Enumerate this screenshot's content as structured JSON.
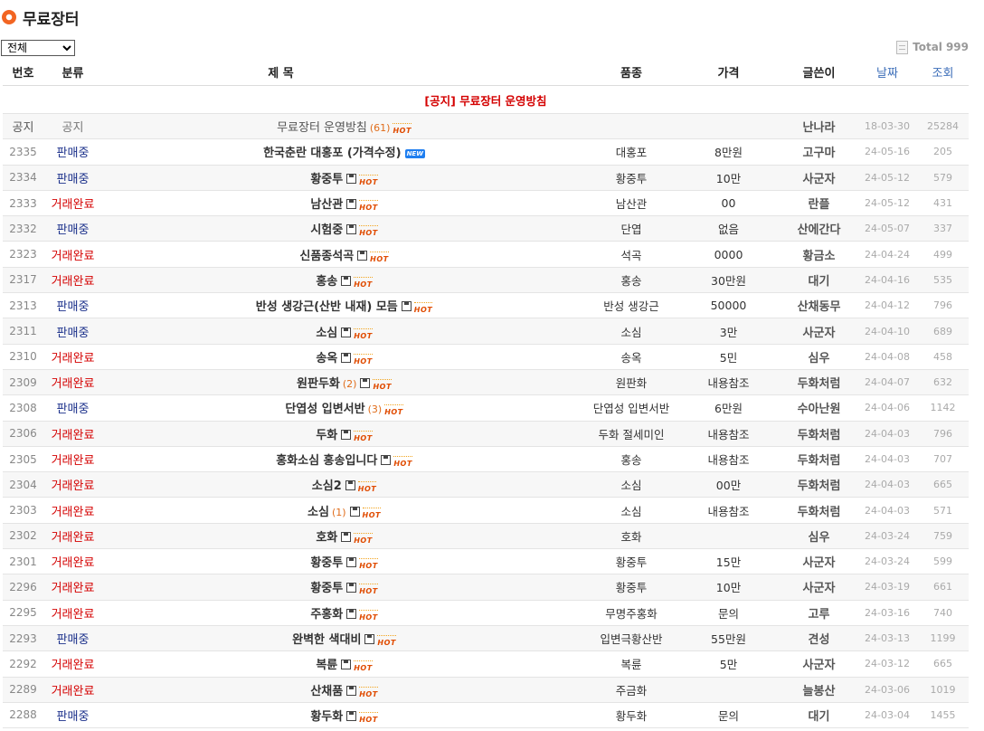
{
  "board": {
    "title": "무료장터",
    "filter": {
      "selected": "전체"
    },
    "total_label": "Total",
    "total_count": "999"
  },
  "columns": {
    "num": "번호",
    "cat": "분류",
    "subject": "제 목",
    "item": "품종",
    "price": "가격",
    "author": "글쓴이",
    "date": "날짜",
    "views": "조회"
  },
  "notice_banner": "[공지] 무료장터 운영방침",
  "rows": [
    {
      "num": "공지",
      "cat": "공지",
      "status": "notice",
      "subject": "무료장터 운영방침",
      "comments": "(61)",
      "file": false,
      "hot": true,
      "new": false,
      "item": "",
      "price": "",
      "author": "난나라",
      "date": "18-03-30",
      "views": "25284"
    },
    {
      "num": "2335",
      "cat": "판매중",
      "status": "sale",
      "subject": "한국춘란 대홍포 (가격수정)",
      "comments": "",
      "file": false,
      "hot": false,
      "new": true,
      "item": "대홍포",
      "price": "8만원",
      "author": "고구마",
      "date": "24-05-16",
      "views": "205"
    },
    {
      "num": "2334",
      "cat": "판매중",
      "status": "sale",
      "subject": "황중투",
      "comments": "",
      "file": true,
      "hot": true,
      "new": false,
      "item": "황중투",
      "price": "10만",
      "author": "사군자",
      "date": "24-05-12",
      "views": "579"
    },
    {
      "num": "2333",
      "cat": "거래완료",
      "status": "done",
      "subject": "남산관",
      "comments": "",
      "file": true,
      "hot": true,
      "new": false,
      "item": "남산관",
      "price": "00",
      "author": "란플",
      "date": "24-05-12",
      "views": "431"
    },
    {
      "num": "2332",
      "cat": "판매중",
      "status": "sale",
      "subject": "시험중",
      "comments": "",
      "file": true,
      "hot": true,
      "new": false,
      "item": "단엽",
      "price": "없음",
      "author": "산에간다",
      "date": "24-05-07",
      "views": "337"
    },
    {
      "num": "2323",
      "cat": "거래완료",
      "status": "done",
      "subject": "신품종석곡",
      "comments": "",
      "file": true,
      "hot": true,
      "new": false,
      "item": "석곡",
      "price": "0000",
      "author": "황금소",
      "date": "24-04-24",
      "views": "499"
    },
    {
      "num": "2317",
      "cat": "거래완료",
      "status": "done",
      "subject": "홍송",
      "comments": "",
      "file": true,
      "hot": true,
      "new": false,
      "item": "홍송",
      "price": "30만원",
      "author": "대기",
      "date": "24-04-16",
      "views": "535"
    },
    {
      "num": "2313",
      "cat": "판매중",
      "status": "sale",
      "subject": "반성 생강근(산반 내재) 모듬",
      "comments": "",
      "file": true,
      "hot": true,
      "new": false,
      "item": "반성 생강근",
      "price": "50000",
      "author": "산채동무",
      "date": "24-04-12",
      "views": "796"
    },
    {
      "num": "2311",
      "cat": "판매중",
      "status": "sale",
      "subject": "소심",
      "comments": "",
      "file": true,
      "hot": true,
      "new": false,
      "item": "소심",
      "price": "3만",
      "author": "사군자",
      "date": "24-04-10",
      "views": "689"
    },
    {
      "num": "2310",
      "cat": "거래완료",
      "status": "done",
      "subject": "송옥",
      "comments": "",
      "file": true,
      "hot": true,
      "new": false,
      "item": "송옥",
      "price": "5민",
      "author": "심우",
      "date": "24-04-08",
      "views": "458"
    },
    {
      "num": "2309",
      "cat": "거래완료",
      "status": "done",
      "subject": "원판두화",
      "comments": "(2)",
      "file": true,
      "hot": true,
      "new": false,
      "item": "원판화",
      "price": "내용참조",
      "author": "두화처럼",
      "date": "24-04-07",
      "views": "632"
    },
    {
      "num": "2308",
      "cat": "판매중",
      "status": "sale",
      "subject": "단엽성 입변서반",
      "comments": "(3)",
      "file": false,
      "hot": true,
      "new": false,
      "item": "단엽성 입변서반",
      "price": "6만원",
      "author": "수아난원",
      "date": "24-04-06",
      "views": "1142"
    },
    {
      "num": "2306",
      "cat": "거래완료",
      "status": "done",
      "subject": "두화",
      "comments": "",
      "file": true,
      "hot": true,
      "new": false,
      "item": "두화 절세미인",
      "price": "내용참조",
      "author": "두화처럼",
      "date": "24-04-03",
      "views": "796"
    },
    {
      "num": "2305",
      "cat": "거래완료",
      "status": "done",
      "subject": "홍화소심 홍송입니다",
      "comments": "",
      "file": true,
      "hot": true,
      "new": false,
      "item": "홍송",
      "price": "내용참조",
      "author": "두화처럼",
      "date": "24-04-03",
      "views": "707"
    },
    {
      "num": "2304",
      "cat": "거래완료",
      "status": "done",
      "subject": "소심2",
      "comments": "",
      "file": true,
      "hot": true,
      "new": false,
      "item": "소심",
      "price": "00만",
      "author": "두화처럼",
      "date": "24-04-03",
      "views": "665"
    },
    {
      "num": "2303",
      "cat": "거래완료",
      "status": "done",
      "subject": "소심",
      "comments": "(1)",
      "file": true,
      "hot": true,
      "new": false,
      "item": "소심",
      "price": "내용참조",
      "author": "두화처럼",
      "date": "24-04-03",
      "views": "571"
    },
    {
      "num": "2302",
      "cat": "거래완료",
      "status": "done",
      "subject": "호화",
      "comments": "",
      "file": true,
      "hot": true,
      "new": false,
      "item": "호화",
      "price": "",
      "author": "심우",
      "date": "24-03-24",
      "views": "759"
    },
    {
      "num": "2301",
      "cat": "거래완료",
      "status": "done",
      "subject": "황중투",
      "comments": "",
      "file": true,
      "hot": true,
      "new": false,
      "item": "황중투",
      "price": "15만",
      "author": "사군자",
      "date": "24-03-24",
      "views": "599"
    },
    {
      "num": "2296",
      "cat": "거래완료",
      "status": "done",
      "subject": "황중투",
      "comments": "",
      "file": true,
      "hot": true,
      "new": false,
      "item": "황중투",
      "price": "10만",
      "author": "사군자",
      "date": "24-03-19",
      "views": "661"
    },
    {
      "num": "2295",
      "cat": "거래완료",
      "status": "done",
      "subject": "주홍화",
      "comments": "",
      "file": true,
      "hot": true,
      "new": false,
      "item": "무명주홍화",
      "price": "문의",
      "author": "고루",
      "date": "24-03-16",
      "views": "740"
    },
    {
      "num": "2293",
      "cat": "판매중",
      "status": "sale",
      "subject": "완벽한 색대비",
      "comments": "",
      "file": true,
      "hot": true,
      "new": false,
      "item": "입변극황산반",
      "price": "55만원",
      "author": "견성",
      "date": "24-03-13",
      "views": "1199"
    },
    {
      "num": "2292",
      "cat": "거래완료",
      "status": "done",
      "subject": "복륜",
      "comments": "",
      "file": true,
      "hot": true,
      "new": false,
      "item": "복륜",
      "price": "5만",
      "author": "사군자",
      "date": "24-03-12",
      "views": "665"
    },
    {
      "num": "2289",
      "cat": "거래완료",
      "status": "done",
      "subject": "산채품",
      "comments": "",
      "file": true,
      "hot": true,
      "new": false,
      "item": "주금화",
      "price": "",
      "author": "늘봉산",
      "date": "24-03-06",
      "views": "1019"
    },
    {
      "num": "2288",
      "cat": "판매중",
      "status": "sale",
      "subject": "황두화",
      "comments": "",
      "file": true,
      "hot": true,
      "new": false,
      "item": "황두화",
      "price": "문의",
      "author": "대기",
      "date": "24-03-04",
      "views": "1455"
    }
  ],
  "badges": {
    "hot": "HOT",
    "new": "NEW"
  },
  "colors": {
    "accent": "#f26522",
    "sale": "#1a2f8a",
    "done": "#d40000",
    "hot": "#e04b00",
    "new": "#1e7ef0"
  }
}
